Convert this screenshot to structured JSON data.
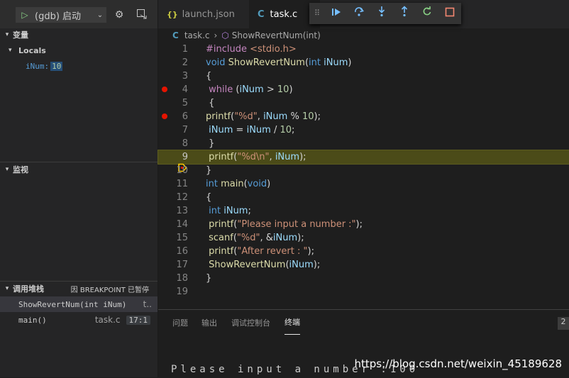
{
  "debug": {
    "config_label": "(gdb) 启动",
    "icons": [
      "play-icon",
      "chevron-down-icon",
      "gear-icon",
      "debug-console-icon"
    ]
  },
  "sidebar": {
    "variables_title": "变量",
    "locals_title": "Locals",
    "variable": {
      "name": "iNum:",
      "value": "10"
    },
    "watch_title": "监视",
    "callstack_title": "调用堆栈",
    "paused_label": "因 BREAKPOINT 已暂停",
    "frames": [
      {
        "fn": "ShowRevertNum(int iNum)",
        "file": "t..",
        "line": ""
      },
      {
        "fn": "main()",
        "file": "task.c",
        "line": "17:1"
      }
    ]
  },
  "tabs": [
    {
      "label": "launch.json",
      "icon": "{}"
    },
    {
      "label": "task.c",
      "icon": "C"
    }
  ],
  "breadcrumb": {
    "file": "task.c",
    "symbol": "ShowRevertNum(int)"
  },
  "code_lines": [
    {
      "n": "1",
      "text": "#include <stdio.h>"
    },
    {
      "n": "2",
      "text": "void ShowRevertNum(int iNum)"
    },
    {
      "n": "3",
      "text": "{"
    },
    {
      "n": "4",
      "text": " while (iNum > 10)"
    },
    {
      "n": "5",
      "text": " {"
    },
    {
      "n": "6",
      "text": "printf(\"%d\", iNum % 10);"
    },
    {
      "n": "7",
      "text": " iNum = iNum / 10;"
    },
    {
      "n": "8",
      "text": " }"
    },
    {
      "n": "9",
      "text": " printf(\"%d\\n\", iNum);"
    },
    {
      "n": "10",
      "text": "}"
    },
    {
      "n": "11",
      "text": "int main(void)"
    },
    {
      "n": "12",
      "text": "{"
    },
    {
      "n": "13",
      "text": " int iNum;"
    },
    {
      "n": "14",
      "text": " printf(\"Please input a number :\");"
    },
    {
      "n": "15",
      "text": " scanf(\"%d\", &iNum);"
    },
    {
      "n": "16",
      "text": " printf(\"After revert : \");"
    },
    {
      "n": "17",
      "text": " ShowRevertNum(iNum);"
    },
    {
      "n": "18",
      "text": "}"
    },
    {
      "n": "19",
      "text": ""
    }
  ],
  "breakpoint_lines": [
    "4",
    "6"
  ],
  "current_line": "9",
  "panel": {
    "tabs": [
      "问题",
      "输出",
      "调试控制台",
      "终端"
    ],
    "active_tab": "终端",
    "badge": "2",
    "terminal_text": "Please input a number :100"
  },
  "watermark": "https://blog.csdn.net/weixin_45189628",
  "colors": {
    "background": "#1e1e1e",
    "sidebar": "#252526",
    "breakpoint": "#e51400",
    "current_line_bg": "#4b4b18",
    "accent_blue": "#75beff",
    "continue_green": "#89d185"
  }
}
